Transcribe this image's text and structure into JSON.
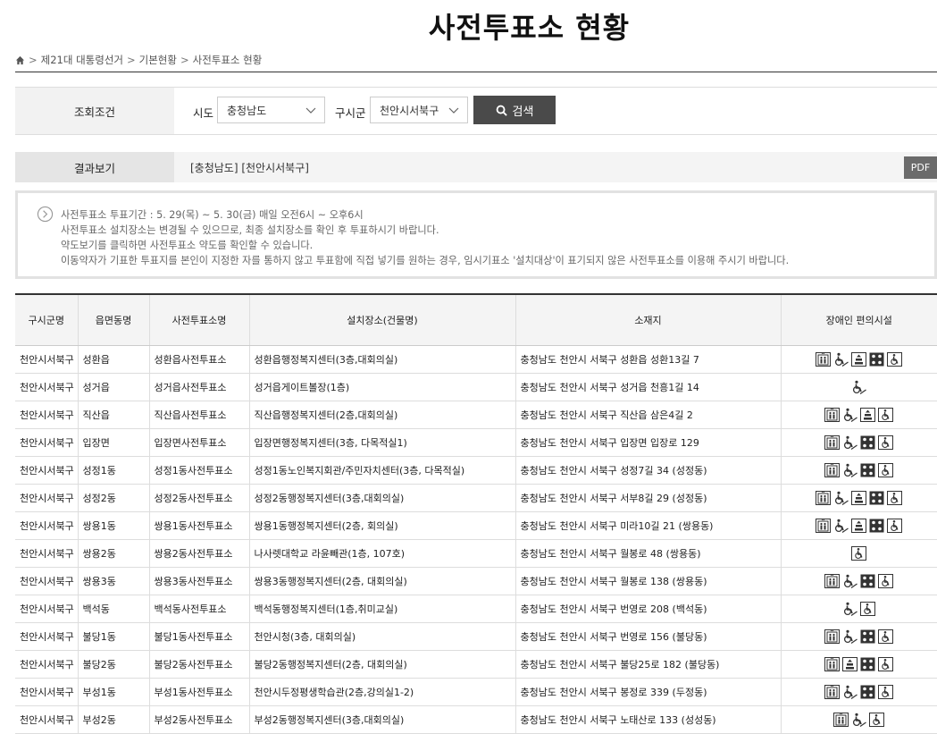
{
  "page": {
    "title": "사전투표소 현황"
  },
  "breadcrumb": {
    "items": [
      "제21대 대통령선거",
      "기본현황",
      "사전투표소 현황"
    ],
    "separator": ">"
  },
  "search": {
    "label": "조회조건",
    "sido_label": "시도",
    "sido_value": "충청남도",
    "gu_label": "구시군",
    "gu_value": "천안시서북구",
    "button_label": "검색"
  },
  "result": {
    "label": "결과보기",
    "text": "[충청남도] [천안시서북구]",
    "pdf_label": "PDF"
  },
  "notice": {
    "lines": [
      "사전투표소 투표기간 : 5. 29(목) ~ 5. 30(금) 매일 오전6시 ~ 오후6시",
      "사전투표소 설치장소는 변경될 수 있으므로, 최종 설치장소를 확인 후 투표하시기 바랍니다.",
      "약도보기를 클릭하면 사전투표소 약도를 확인할 수 있습니다.",
      "이동약자가 기표한 투표지를 본인이 지정한 자를 통하지 않고 투표함에 직접 넣기를 원하는 경우, 임시기표소 '설치대상'이 표기되지 않은 사전투표소를 이용해 주시기 바랍니다."
    ]
  },
  "table": {
    "headers": [
      "구시군명",
      "읍면동명",
      "사전투표소명",
      "설치장소(건물명)",
      "소재지",
      "장애인 편의시설"
    ],
    "rows": [
      {
        "gu": "천안시서북구",
        "dong": "성환읍",
        "name": "성환읍사전투표소",
        "place": "성환읍행정복지센터(3층,대회의실)",
        "addr": "충청남도 천안시 서북구 성환읍 성환13길 7",
        "fac": [
          "elevator-icon",
          "wheelchair-ramp-icon",
          "elevator-button-icon",
          "braille-icon",
          "wheelchair-icon"
        ]
      },
      {
        "gu": "천안시서북구",
        "dong": "성거읍",
        "name": "성거읍사전투표소",
        "place": "성거읍게이트볼장(1층)",
        "addr": "충청남도 천안시 서북구 성거읍 천흥1길 14",
        "fac": [
          "wheelchair-ramp-icon"
        ]
      },
      {
        "gu": "천안시서북구",
        "dong": "직산읍",
        "name": "직산읍사전투표소",
        "place": "직산읍행정복지센터(2층,대회의실)",
        "addr": "충청남도 천안시 서북구 직산읍 삼은4길 2",
        "fac": [
          "elevator-icon",
          "wheelchair-ramp-icon",
          "elevator-button-icon",
          "wheelchair-icon"
        ]
      },
      {
        "gu": "천안시서북구",
        "dong": "입장면",
        "name": "입장면사전투표소",
        "place": "입장면행정복지센터(3층, 다목적실1)",
        "addr": "충청남도 천안시 서북구 입장면 입장로 129",
        "fac": [
          "elevator-icon",
          "wheelchair-ramp-icon",
          "braille-icon",
          "wheelchair-icon"
        ]
      },
      {
        "gu": "천안시서북구",
        "dong": "성정1동",
        "name": "성정1동사전투표소",
        "place": "성정1동노인복지회관/주민자치센터(3층, 다목적실)",
        "addr": "충청남도 천안시 서북구 성정7길 34 (성정동)",
        "fac": [
          "elevator-icon",
          "wheelchair-ramp-icon",
          "braille-icon",
          "wheelchair-icon"
        ]
      },
      {
        "gu": "천안시서북구",
        "dong": "성정2동",
        "name": "성정2동사전투표소",
        "place": "성정2동행정복지센터(3층,대회의실)",
        "addr": "충청남도 천안시 서북구 서부8길 29 (성정동)",
        "fac": [
          "elevator-icon",
          "wheelchair-ramp-icon",
          "elevator-button-icon",
          "braille-icon",
          "wheelchair-icon"
        ]
      },
      {
        "gu": "천안시서북구",
        "dong": "쌍용1동",
        "name": "쌍용1동사전투표소",
        "place": "쌍용1동행정복지센터(2층, 회의실)",
        "addr": "충청남도 천안시 서북구 미라10길 21 (쌍용동)",
        "fac": [
          "elevator-icon",
          "wheelchair-ramp-icon",
          "elevator-button-icon",
          "braille-icon",
          "wheelchair-icon"
        ]
      },
      {
        "gu": "천안시서북구",
        "dong": "쌍용2동",
        "name": "쌍용2동사전투표소",
        "place": "나사렛대학교 라윤빼관(1층, 107호)",
        "addr": "충청남도 천안시 서북구 월봉로 48 (쌍용동)",
        "fac": [
          "wheelchair-icon"
        ]
      },
      {
        "gu": "천안시서북구",
        "dong": "쌍용3동",
        "name": "쌍용3동사전투표소",
        "place": "쌍용3동행정복지센터(2층, 대회의실)",
        "addr": "충청남도 천안시 서북구 월봉로 138 (쌍용동)",
        "fac": [
          "elevator-icon",
          "wheelchair-ramp-icon",
          "braille-icon",
          "wheelchair-icon"
        ]
      },
      {
        "gu": "천안시서북구",
        "dong": "백석동",
        "name": "백석동사전투표소",
        "place": "백석동행정복지센터(1층,취미교실)",
        "addr": "충청남도 천안시 서북구 번영로 208 (백석동)",
        "fac": [
          "wheelchair-ramp-icon",
          "wheelchair-icon"
        ]
      },
      {
        "gu": "천안시서북구",
        "dong": "불당1동",
        "name": "불당1동사전투표소",
        "place": "천안시청(3층, 대회의실)",
        "addr": "충청남도 천안시 서북구 번영로 156 (불당동)",
        "fac": [
          "elevator-icon",
          "wheelchair-ramp-icon",
          "braille-icon",
          "wheelchair-icon"
        ]
      },
      {
        "gu": "천안시서북구",
        "dong": "불당2동",
        "name": "불당2동사전투표소",
        "place": "불당2동행정복지센터(2층, 대회의실)",
        "addr": "충청남도 천안시 서북구 불당25로 182 (불당동)",
        "fac": [
          "elevator-icon",
          "elevator-button-icon",
          "braille-icon",
          "wheelchair-icon"
        ]
      },
      {
        "gu": "천안시서북구",
        "dong": "부성1동",
        "name": "부성1동사전투표소",
        "place": "천안시두정평생학습관(2층,강의실1-2)",
        "addr": "충청남도 천안시 서북구 봉정로 339 (두정동)",
        "fac": [
          "elevator-icon",
          "wheelchair-ramp-icon",
          "braille-icon",
          "wheelchair-icon"
        ]
      },
      {
        "gu": "천안시서북구",
        "dong": "부성2동",
        "name": "부성2동사전투표소",
        "place": "부성2동행정복지센터(3층,대회의실)",
        "addr": "충청남도 천안시 서북구 노태산로 133 (성성동)",
        "fac": [
          "elevator-icon",
          "wheelchair-ramp-icon",
          "wheelchair-icon"
        ]
      }
    ]
  }
}
